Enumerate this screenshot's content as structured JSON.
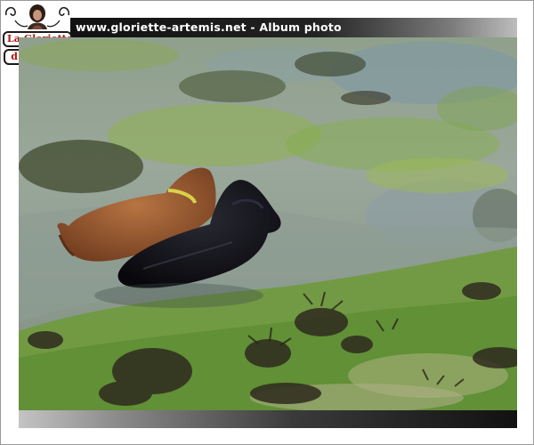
{
  "header": {
    "title": "www.gloriette-artemis.net - Album photo"
  },
  "logo": {
    "line1": "La Gloriette",
    "line2": "d'Artémis"
  },
  "photo": {
    "subject": "two dogs wading in a tide pool"
  },
  "colors": {
    "header_dark": "#111111",
    "logo_text": "#b01212",
    "frame_border": "#9a9a9a"
  }
}
